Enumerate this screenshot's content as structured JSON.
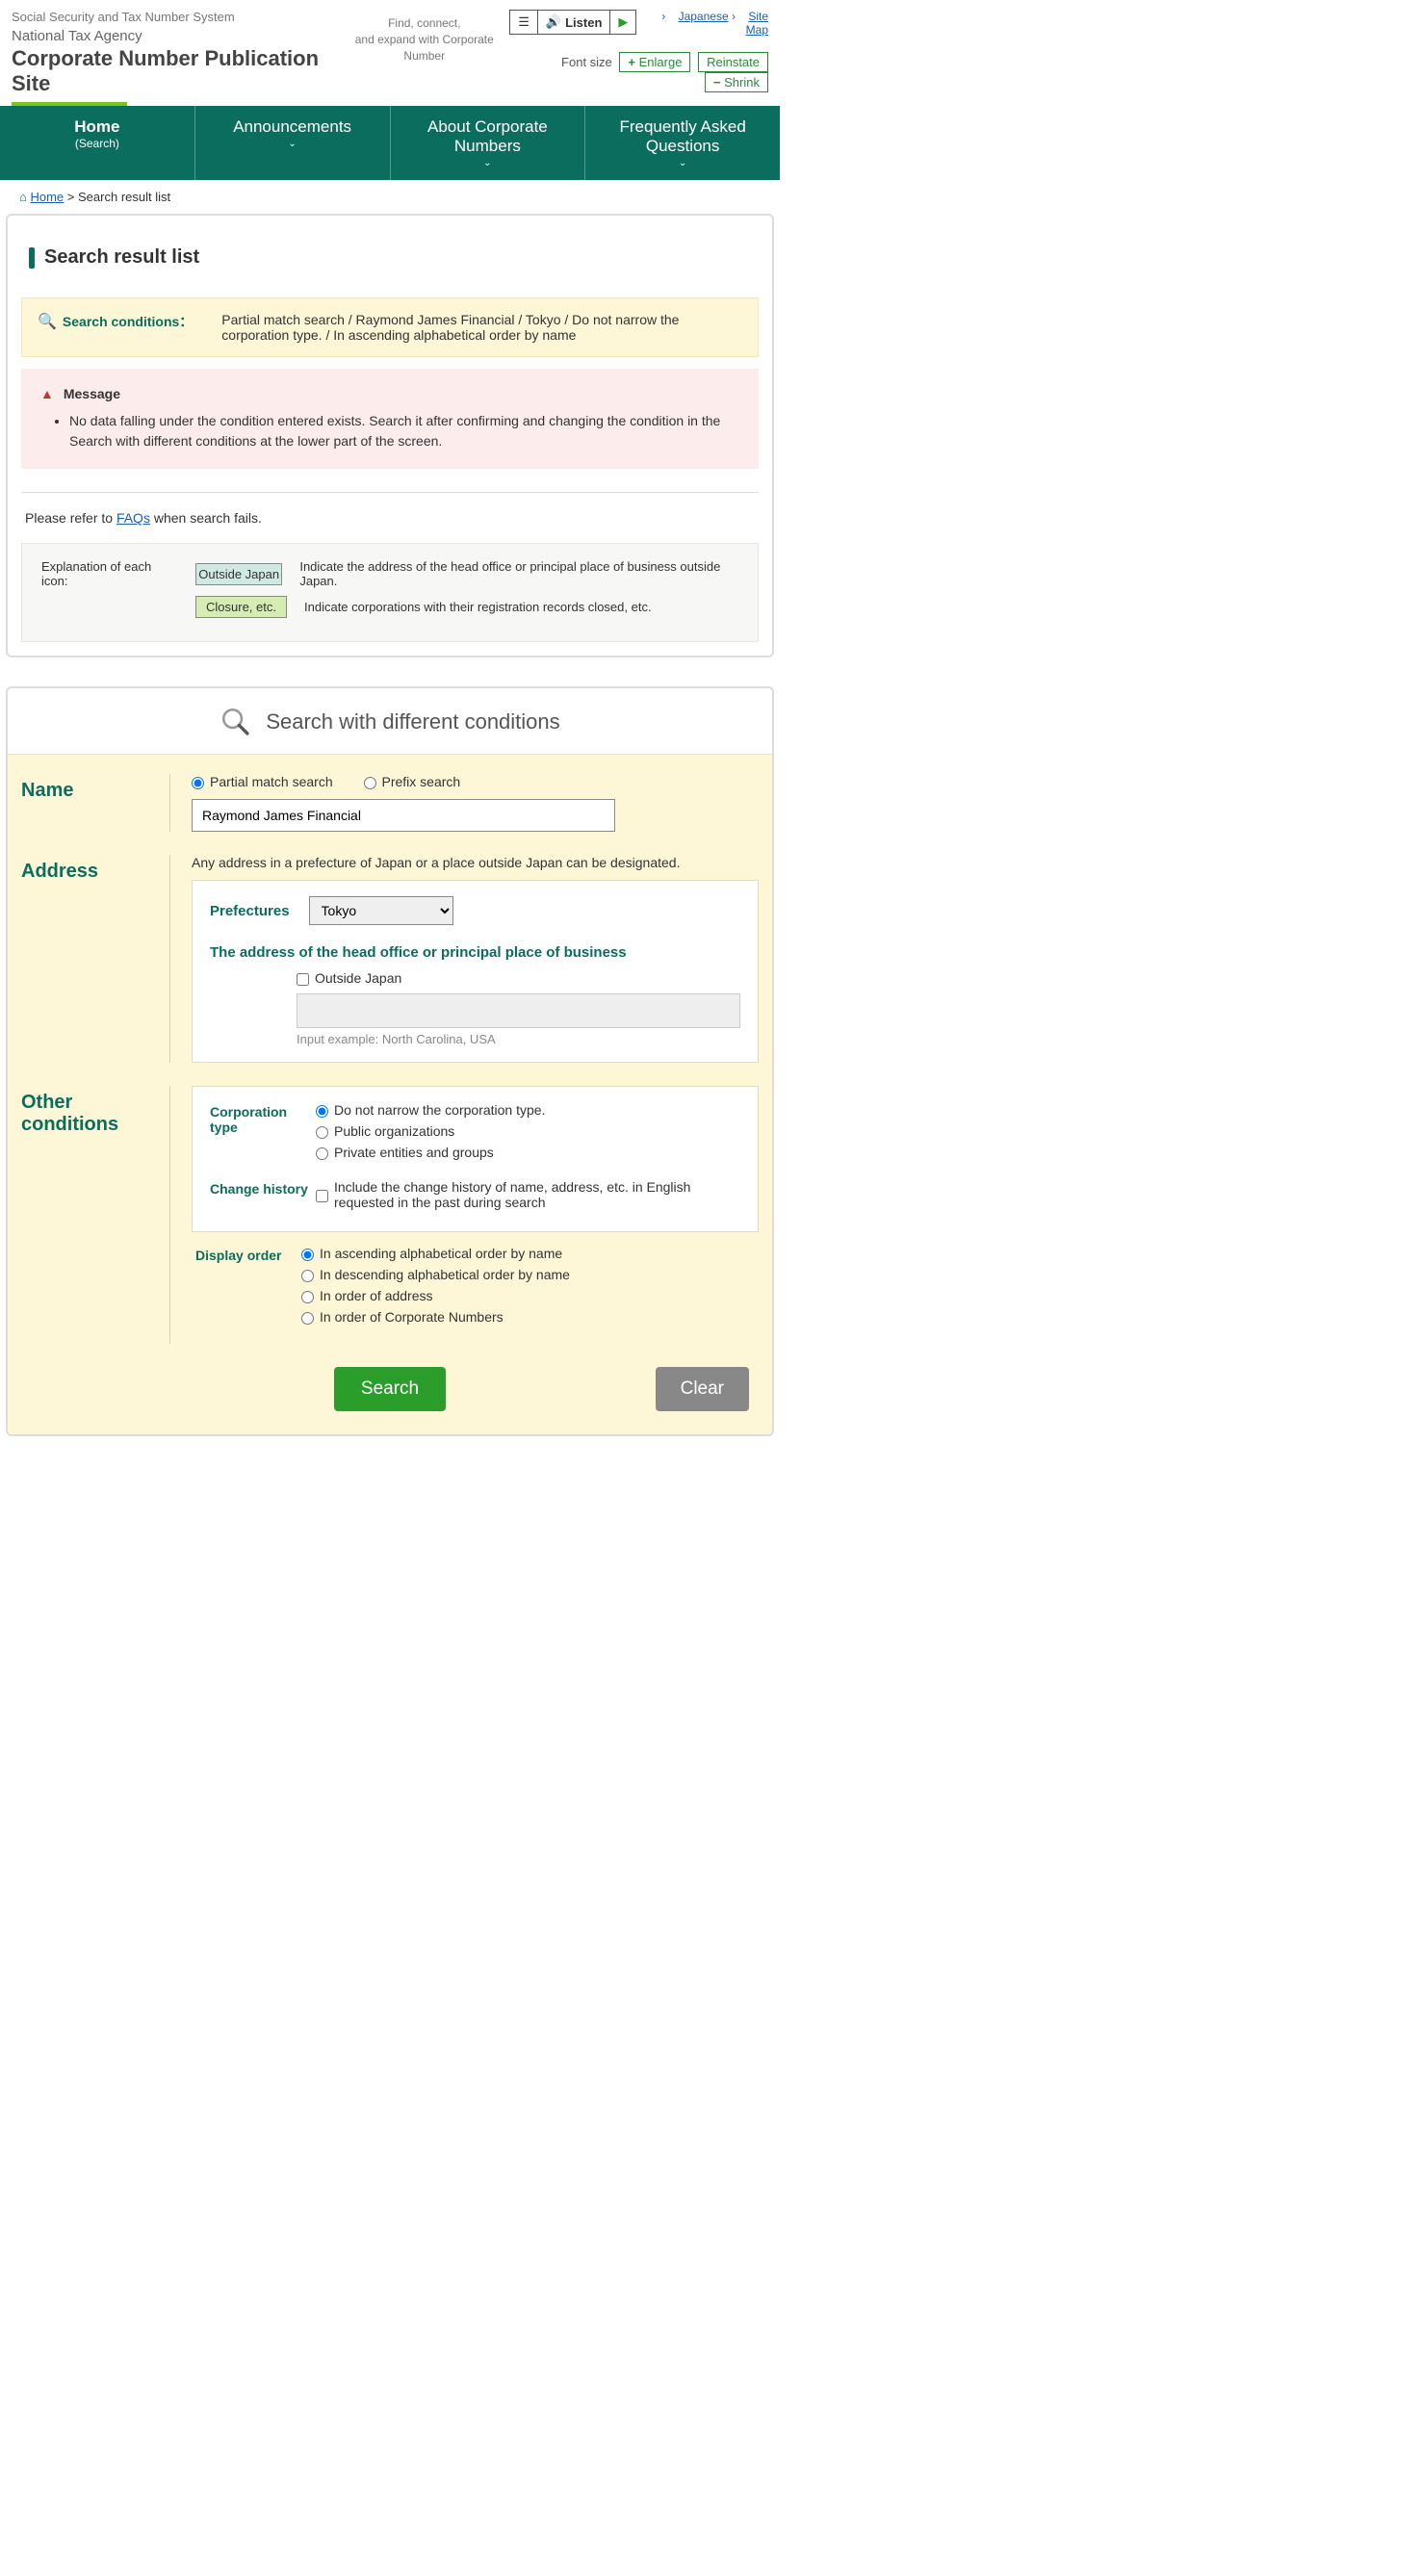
{
  "header": {
    "system_label": "Social Security and Tax Number System",
    "agency": "National Tax Agency",
    "site_title": "Corporate Number Publication Site",
    "tagline1": "Find, connect,",
    "tagline2": "and expand with Corporate Number",
    "listen": "Listen",
    "link_japanese": "Japanese",
    "link_sitemap": "Site Map",
    "fontsize_label": "Font size",
    "btn_enlarge": "Enlarge",
    "btn_reinstate": "Reinstate",
    "btn_shrink": "Shrink"
  },
  "nav": {
    "home": "Home",
    "home_sub": "(Search)",
    "announcements": "Announcements",
    "about": "About Corporate Numbers",
    "faq": "Frequently Asked Questions"
  },
  "breadcrumb": {
    "home": "Home",
    "sep": ">",
    "current": "Search result list"
  },
  "page": {
    "heading": "Search result list",
    "cond_label": "Search conditions：",
    "cond_text": "Partial match search / Raymond James Financial / Tokyo / Do not narrow the corporation type. / In ascending alphabetical order by name",
    "msg_head": "Message",
    "msg_body": "No data falling under the condition entered exists. Search it after confirming and changing the condition in the Search with different conditions at the lower part of the screen.",
    "refer_pre": "Please refer to ",
    "refer_link": "FAQs",
    "refer_post": " when search fails.",
    "icon_expl_label": "Explanation of each icon:",
    "tag_outside": "Outside Japan",
    "tag_outside_desc": "Indicate the address of the head office or principal place of business outside Japan.",
    "tag_closure": "Closure, etc.",
    "tag_closure_desc": "Indicate corporations with their registration records closed, etc."
  },
  "search_panel": {
    "title": "Search with different conditions",
    "name_label": "Name",
    "radio_partial": "Partial match search",
    "radio_prefix": "Prefix search",
    "name_value": "Raymond James Financial",
    "address_label": "Address",
    "address_note": "Any address in a prefecture of Japan or a place outside Japan can be designated.",
    "prefectures_label": "Prefectures",
    "prefecture_selected": "Tokyo",
    "head_office_label": "The address of the head office or principal place of business",
    "outside_japan_cb": "Outside Japan",
    "input_example": "Input example: North Carolina, USA",
    "other_label": "Other conditions",
    "corp_type_label": "Corporation type",
    "corp_opt1": "Do not narrow the corporation type.",
    "corp_opt2": "Public organizations",
    "corp_opt3": "Private entities and groups",
    "change_hist_label": "Change history",
    "change_hist_cb": "Include the change history of name, address, etc. in English requested in the past during search",
    "display_order_label": "Display order",
    "order_opt1": "In ascending alphabetical order by name",
    "order_opt2": "In descending alphabetical order by name",
    "order_opt3": "In order of address",
    "order_opt4": "In order of Corporate Numbers",
    "btn_search": "Search",
    "btn_clear": "Clear"
  }
}
